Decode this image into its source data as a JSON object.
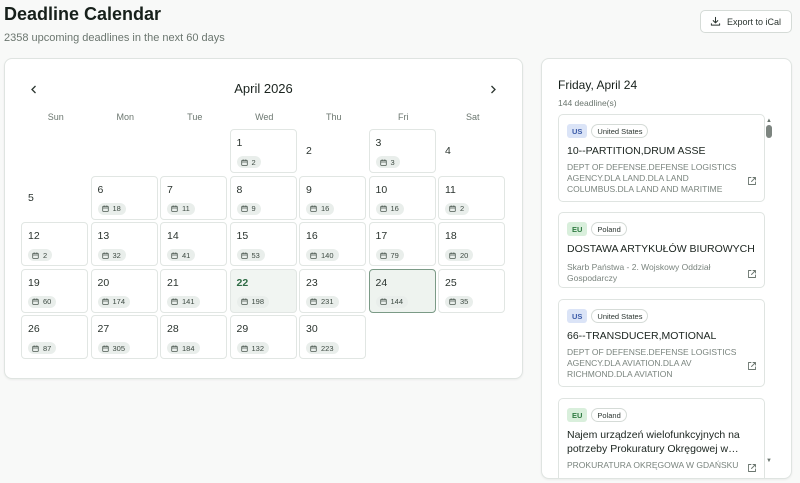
{
  "header": {
    "title": "Deadline Calendar",
    "subtitle": "2358 upcoming deadlines in the next 60 days",
    "export_label": "Export to iCal"
  },
  "calendar": {
    "month_title": "April 2026",
    "weekdays": [
      "Sun",
      "Mon",
      "Tue",
      "Wed",
      "Thu",
      "Fri",
      "Sat"
    ],
    "days": [
      {
        "day": "1",
        "count": "2",
        "col": 3,
        "row": 0
      },
      {
        "day": "2",
        "count": "",
        "col": 4,
        "row": 0
      },
      {
        "day": "3",
        "count": "3",
        "col": 5,
        "row": 0
      },
      {
        "day": "4",
        "count": "",
        "col": 6,
        "row": 0
      },
      {
        "day": "5",
        "count": "",
        "col": 0,
        "row": 1
      },
      {
        "day": "6",
        "count": "18",
        "col": 1,
        "row": 1
      },
      {
        "day": "7",
        "count": "11",
        "col": 2,
        "row": 1
      },
      {
        "day": "8",
        "count": "9",
        "col": 3,
        "row": 1
      },
      {
        "day": "9",
        "count": "16",
        "col": 4,
        "row": 1
      },
      {
        "day": "10",
        "count": "16",
        "col": 5,
        "row": 1
      },
      {
        "day": "11",
        "count": "2",
        "col": 6,
        "row": 1
      },
      {
        "day": "12",
        "count": "2",
        "col": 0,
        "row": 2
      },
      {
        "day": "13",
        "count": "32",
        "col": 1,
        "row": 2
      },
      {
        "day": "14",
        "count": "41",
        "col": 2,
        "row": 2
      },
      {
        "day": "15",
        "count": "53",
        "col": 3,
        "row": 2
      },
      {
        "day": "16",
        "count": "140",
        "col": 4,
        "row": 2
      },
      {
        "day": "17",
        "count": "79",
        "col": 5,
        "row": 2
      },
      {
        "day": "18",
        "count": "20",
        "col": 6,
        "row": 2
      },
      {
        "day": "19",
        "count": "60",
        "col": 0,
        "row": 3
      },
      {
        "day": "20",
        "count": "174",
        "col": 1,
        "row": 3
      },
      {
        "day": "21",
        "count": "141",
        "col": 2,
        "row": 3
      },
      {
        "day": "22",
        "count": "198",
        "col": 3,
        "row": 3,
        "today": true
      },
      {
        "day": "23",
        "count": "231",
        "col": 4,
        "row": 3
      },
      {
        "day": "24",
        "count": "144",
        "col": 5,
        "row": 3,
        "selected": true
      },
      {
        "day": "25",
        "count": "35",
        "col": 6,
        "row": 3
      },
      {
        "day": "26",
        "count": "87",
        "col": 0,
        "row": 4
      },
      {
        "day": "27",
        "count": "305",
        "col": 1,
        "row": 4
      },
      {
        "day": "28",
        "count": "184",
        "col": 2,
        "row": 4
      },
      {
        "day": "29",
        "count": "132",
        "col": 3,
        "row": 4
      },
      {
        "day": "30",
        "count": "223",
        "col": 4,
        "row": 4
      }
    ]
  },
  "sidebar": {
    "title": "Friday, April 24",
    "count_label": "144 deadline(s)",
    "items": [
      {
        "region": "US",
        "country": "United States",
        "title": "10--PARTITION,DRUM ASSE",
        "agency": "DEPT OF DEFENSE.DEFENSE LOGISTICS AGENCY.DLA LAND.DLA LAND COLUMBUS.DLA LAND AND MARITIME"
      },
      {
        "region": "EU",
        "country": "Poland",
        "title": "DOSTAWA ARTYKUŁÓW BIUROWYCH",
        "agency": "Skarb Państwa - 2. Wojskowy Oddział Gospodarczy"
      },
      {
        "region": "US",
        "country": "United States",
        "title": "66--TRANSDUCER,MOTIONAL",
        "agency": "DEPT OF DEFENSE.DEFENSE LOGISTICS AGENCY.DLA AVIATION.DLA AV RICHMOND.DLA AVIATION"
      },
      {
        "region": "EU",
        "country": "Poland",
        "title": "Najem urządzeń wielofunkcyjnych na potrzeby Prokuratury Okręgowej w…",
        "agency": "PROKURATURA OKRĘGOWA W GDAŃSKU"
      }
    ]
  }
}
